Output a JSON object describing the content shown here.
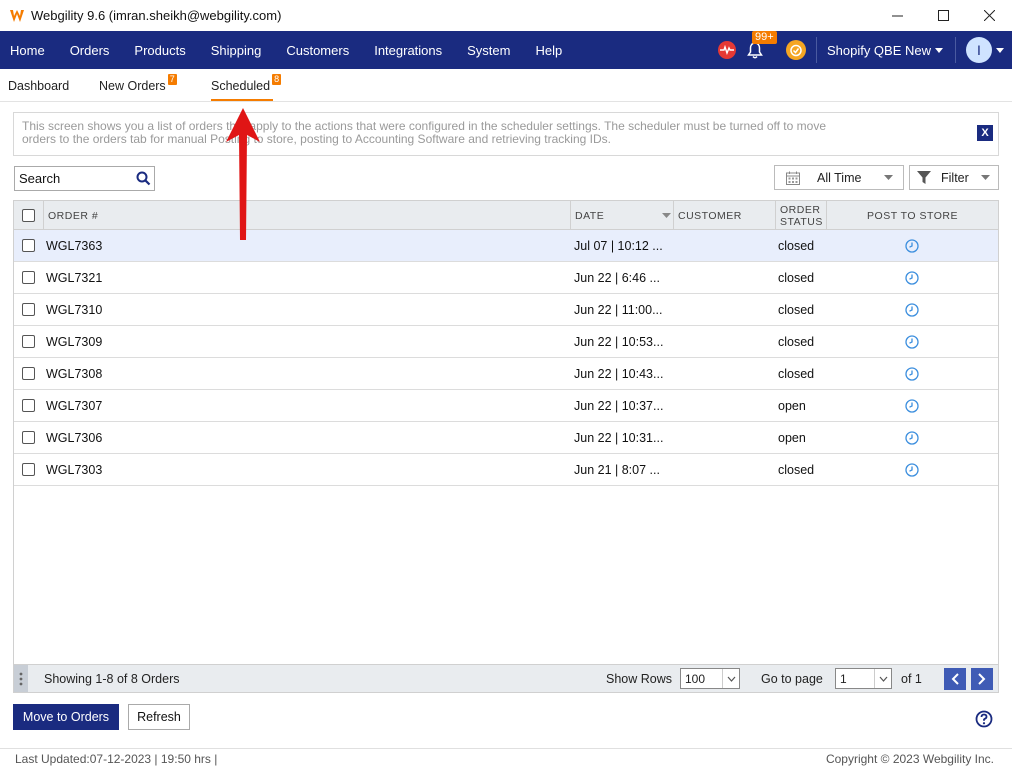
{
  "window": {
    "title": "Webgility 9.6 (imran.sheikh@webgility.com)"
  },
  "nav": {
    "items": [
      "Home",
      "Orders",
      "Products",
      "Shipping",
      "Customers",
      "Integrations",
      "System",
      "Help"
    ],
    "notifications_badge": "99+",
    "store": "Shopify QBE New",
    "avatar_initial": "I"
  },
  "tabs": [
    {
      "label": "Dashboard",
      "badge": ""
    },
    {
      "label": "New Orders",
      "badge": "7"
    },
    {
      "label": "Scheduled",
      "badge": "8",
      "active": true
    }
  ],
  "info": {
    "text": "This screen shows you a list of orders that apply to the actions that were configured in the scheduler settings.  The scheduler must be turned off to move orders to the orders tab for manual Posting to store, posting to Accounting Software and retrieving tracking IDs.",
    "close_label": "X"
  },
  "search": {
    "placeholder": "Search"
  },
  "filters": {
    "time_range": "All Time",
    "filter_label": "Filter"
  },
  "table": {
    "headers": {
      "order": "ORDER #",
      "date": "DATE",
      "customer": "CUSTOMER",
      "order_status_line1": "ORDER",
      "order_status_line2": "STATUS",
      "post_to_store": "POST TO STORE"
    },
    "rows": [
      {
        "order": "WGL7363",
        "date": "Jul 07 | 10:12 ...",
        "customer": "",
        "status": "closed",
        "selected": true
      },
      {
        "order": "WGL7321",
        "date": "Jun 22 | 6:46 ...",
        "customer": "",
        "status": "closed"
      },
      {
        "order": "WGL7310",
        "date": "Jun 22 | 11:00...",
        "customer": "",
        "status": "closed"
      },
      {
        "order": "WGL7309",
        "date": "Jun 22 | 10:53...",
        "customer": "",
        "status": "closed"
      },
      {
        "order": "WGL7308",
        "date": "Jun 22 | 10:43...",
        "customer": "",
        "status": "closed"
      },
      {
        "order": "WGL7307",
        "date": "Jun 22 | 10:37...",
        "customer": "",
        "status": "open"
      },
      {
        "order": "WGL7306",
        "date": "Jun 22 | 10:31...",
        "customer": "",
        "status": "open"
      },
      {
        "order": "WGL7303",
        "date": "Jun 21 | 8:07 ...",
        "customer": "",
        "status": "closed"
      }
    ]
  },
  "pager": {
    "showing": "Showing 1-8 of 8 Orders",
    "show_rows_label": "Show Rows",
    "show_rows_value": "100",
    "goto_label": "Go to page",
    "goto_value": "1",
    "of_label": "of 1"
  },
  "actions": {
    "move_to_orders": "Move to Orders",
    "refresh": "Refresh"
  },
  "status_bar": {
    "last_updated": "Last Updated:07-12-2023 | 19:50 hrs |",
    "copyright": "Copyright © 2023 Webgility Inc."
  },
  "colors": {
    "nav_bg": "#1a2b80",
    "accent_orange": "#f57c00",
    "annotation_red": "#e01515",
    "clock_icon": "#3b8ede"
  }
}
